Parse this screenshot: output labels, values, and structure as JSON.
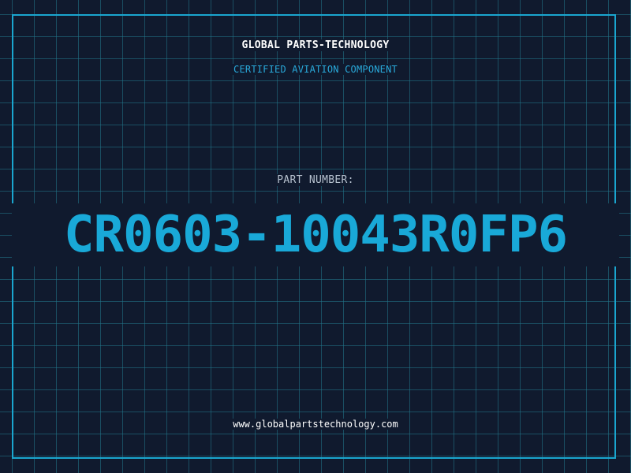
{
  "header": {
    "company": "GLOBAL PARTS-TECHNOLOGY",
    "tagline": "CERTIFIED AVIATION COMPONENT"
  },
  "part": {
    "label": "PART NUMBER:",
    "number": "CR0603-10043R0FP6"
  },
  "footer": {
    "website": "www.globalpartstechnology.com"
  },
  "colors": {
    "background": "#101a2e",
    "grid": "#22788c",
    "accent": "#19a9d8",
    "frame": "#1aa6cf",
    "text": "#ffffff",
    "muted": "#b7c2cf"
  }
}
